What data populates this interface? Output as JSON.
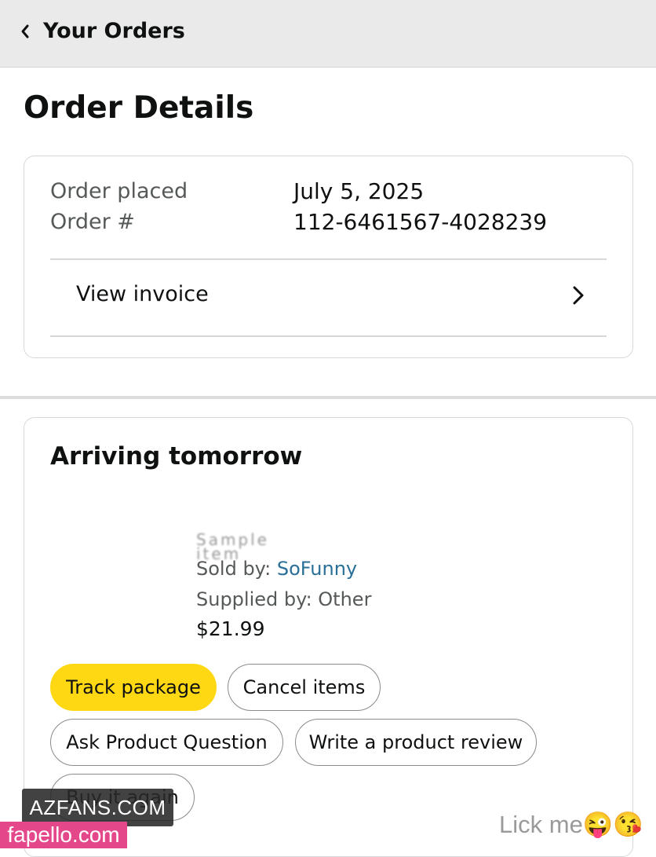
{
  "header": {
    "back_label": "Your Orders",
    "back_icon": "chevron-left-icon"
  },
  "page": {
    "title": "Order Details"
  },
  "summary": {
    "order_placed_label": "Order placed",
    "order_placed_value": "July 5, 2025",
    "order_number_label": "Order #",
    "order_number_value": "112-6461567-4028239",
    "invoice_label": "View invoice",
    "invoice_icon": "chevron-right-icon"
  },
  "shipment": {
    "status": "Arriving tomorrow",
    "item": {
      "title": "Sample item",
      "sold_by_label": "Sold by: ",
      "sold_by_value": "SoFunny",
      "supplied_by": "Supplied by: Other",
      "price": "$21.99"
    },
    "actions": {
      "track": "Track package",
      "cancel": "Cancel items",
      "ask": "Ask Product Question",
      "review": "Write a product review",
      "buy_again": "Buy it again"
    }
  },
  "overlays": {
    "watermark_site": "AZFANS.COM",
    "watermark_site2": "fapello.com",
    "caption": "Lick me😜😘"
  },
  "colors": {
    "primary_button": "#ffd814",
    "link": "#2a6f97",
    "topbar": "#eaeaea"
  }
}
